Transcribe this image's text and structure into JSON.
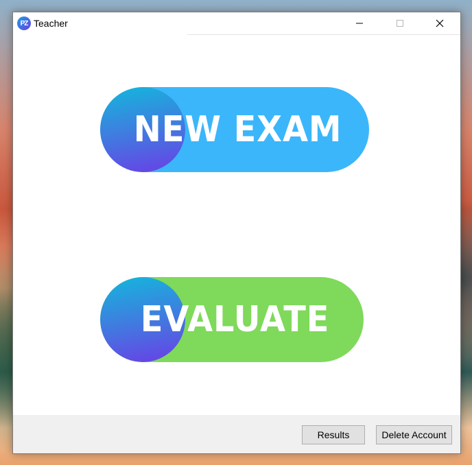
{
  "window": {
    "title": "Teacher",
    "icon_text": "PZ"
  },
  "main": {
    "new_exam_label": "NEW EXAM",
    "evaluate_label": "EVALUATE"
  },
  "footer": {
    "results_label": "Results",
    "delete_account_label": "Delete Account"
  },
  "colors": {
    "new_exam_pill": "#3bb6fb",
    "evaluate_pill": "#7fd95b",
    "circle_gradient_start": "#13b7dc",
    "circle_gradient_end": "#6a3ee6",
    "footer_bg": "#f0f0f0"
  },
  "icons": {
    "minimize": "minimize-icon",
    "maximize": "maximize-icon",
    "close": "close-icon"
  }
}
